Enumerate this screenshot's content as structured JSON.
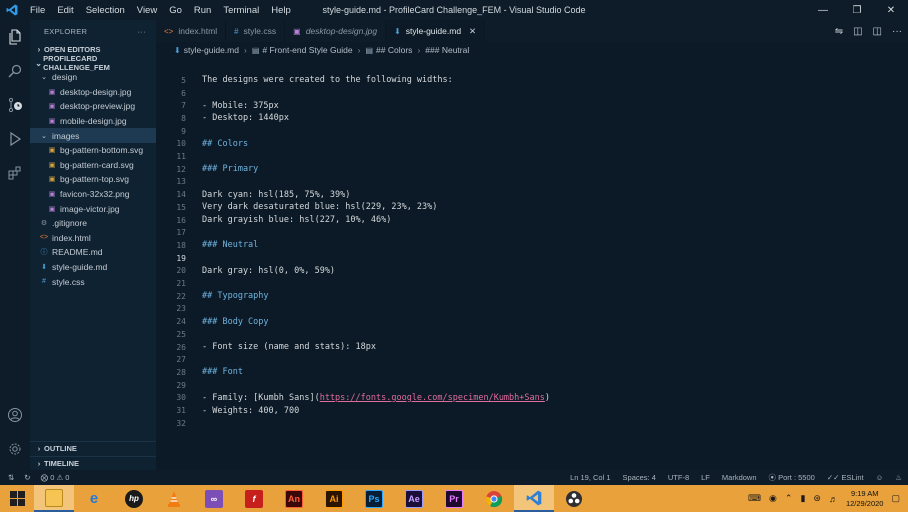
{
  "window": {
    "title": "style-guide.md - ProfileCard Challenge_FEM - Visual Studio Code",
    "menu": [
      "File",
      "Edit",
      "Selection",
      "View",
      "Go",
      "Run",
      "Terminal",
      "Help"
    ]
  },
  "sidebar": {
    "explorer_label": "EXPLORER",
    "open_editors_label": "OPEN EDITORS",
    "project_label": "PROFILECARD CHALLENGE_FEM",
    "tree": [
      {
        "label": "design",
        "kind": "folder",
        "depth": 1,
        "icon": "chevron-down-icon"
      },
      {
        "label": "desktop-design.jpg",
        "kind": "image",
        "depth": 2,
        "icon": "image-file-icon"
      },
      {
        "label": "desktop-preview.jpg",
        "kind": "image",
        "depth": 2,
        "icon": "image-file-icon"
      },
      {
        "label": "mobile-design.jpg",
        "kind": "image",
        "depth": 2,
        "icon": "image-file-icon"
      },
      {
        "label": "images",
        "kind": "folder",
        "depth": 1,
        "icon": "chevron-down-icon",
        "selected": true
      },
      {
        "label": "bg-pattern-bottom.svg",
        "kind": "svg",
        "depth": 2,
        "icon": "image-file-icon"
      },
      {
        "label": "bg-pattern-card.svg",
        "kind": "svg",
        "depth": 2,
        "icon": "image-file-icon"
      },
      {
        "label": "bg-pattern-top.svg",
        "kind": "svg",
        "depth": 2,
        "icon": "image-file-icon"
      },
      {
        "label": "favicon-32x32.png",
        "kind": "image",
        "depth": 2,
        "icon": "image-file-icon"
      },
      {
        "label": "image-victor.jpg",
        "kind": "image",
        "depth": 2,
        "icon": "image-file-icon"
      },
      {
        "label": ".gitignore",
        "kind": "config",
        "depth": 1,
        "icon": "gear-icon"
      },
      {
        "label": "index.html",
        "kind": "html",
        "depth": 1,
        "icon": "code-file-icon"
      },
      {
        "label": "README.md",
        "kind": "info",
        "depth": 1,
        "icon": "info-icon"
      },
      {
        "label": "style-guide.md",
        "kind": "markdown",
        "depth": 1,
        "icon": "markdown-icon"
      },
      {
        "label": "style.css",
        "kind": "css",
        "depth": 1,
        "icon": "hash-icon"
      }
    ],
    "outline_label": "OUTLINE",
    "timeline_label": "TIMELINE"
  },
  "tabs": [
    {
      "label": "index.html",
      "icon": "code-file-icon",
      "active": false
    },
    {
      "label": "style.css",
      "icon": "hash-icon",
      "active": false
    },
    {
      "label": "desktop-design.jpg",
      "icon": "image-file-icon",
      "active": false
    },
    {
      "label": "style-guide.md",
      "icon": "markdown-icon",
      "active": true
    }
  ],
  "breadcrumb": [
    "style-guide.md",
    "# Front-end Style Guide",
    "## Colors",
    "### Neutral"
  ],
  "editor": {
    "current_line": 19,
    "lines": [
      {
        "n": 5,
        "text": "The designs were created to the following widths:",
        "kind": "text"
      },
      {
        "n": 6,
        "text": "",
        "kind": "text"
      },
      {
        "n": 7,
        "text": "- Mobile: 375px",
        "kind": "text"
      },
      {
        "n": 8,
        "text": "- Desktop: 1440px",
        "kind": "text"
      },
      {
        "n": 9,
        "text": "",
        "kind": "text"
      },
      {
        "n": 10,
        "text": "## Colors",
        "kind": "heading"
      },
      {
        "n": 11,
        "text": "",
        "kind": "text"
      },
      {
        "n": 12,
        "text": "### Primary",
        "kind": "heading"
      },
      {
        "n": 13,
        "text": "",
        "kind": "text"
      },
      {
        "n": 14,
        "text": "Dark cyan: hsl(185, 75%, 39%)",
        "kind": "text"
      },
      {
        "n": 15,
        "text": "Very dark desaturated blue: hsl(229, 23%, 23%)",
        "kind": "text"
      },
      {
        "n": 16,
        "text": "Dark grayish blue: hsl(227, 10%, 46%)",
        "kind": "text"
      },
      {
        "n": 17,
        "text": "",
        "kind": "text"
      },
      {
        "n": 18,
        "text": "### Neutral",
        "kind": "heading"
      },
      {
        "n": 19,
        "text": "",
        "kind": "text"
      },
      {
        "n": 20,
        "text": "Dark gray: hsl(0, 0%, 59%)",
        "kind": "text"
      },
      {
        "n": 21,
        "text": "",
        "kind": "text"
      },
      {
        "n": 22,
        "text": "## Typography",
        "kind": "heading"
      },
      {
        "n": 23,
        "text": "",
        "kind": "text"
      },
      {
        "n": 24,
        "text": "### Body Copy",
        "kind": "heading"
      },
      {
        "n": 25,
        "text": "",
        "kind": "text"
      },
      {
        "n": 26,
        "text": "- Font size (name and stats): 18px",
        "kind": "text"
      },
      {
        "n": 27,
        "text": "",
        "kind": "text"
      },
      {
        "n": 28,
        "text": "### Font",
        "kind": "heading"
      },
      {
        "n": 29,
        "text": "",
        "kind": "text"
      },
      {
        "n": 30,
        "kind": "link",
        "prefix": "- Family: [Kumbh Sans](",
        "url": "https://fonts.google.com/specimen/Kumbh+Sans",
        "suffix": ")"
      },
      {
        "n": 31,
        "text": "- Weights: 400, 700",
        "kind": "text"
      },
      {
        "n": 32,
        "text": "",
        "kind": "text"
      }
    ]
  },
  "statusbar": {
    "errors": "0",
    "warnings": "0",
    "position": "Ln 19, Col 1",
    "spaces": "Spaces: 4",
    "encoding": "UTF-8",
    "eol": "LF",
    "language": "Markdown",
    "port": "Port : 5500",
    "eslint": "ESLint"
  },
  "taskbar": {
    "time": "9:19 AM",
    "date": "12/29/2020",
    "apps": [
      {
        "name": "file-explorer",
        "label": ""
      },
      {
        "name": "internet-explorer",
        "label": "e"
      },
      {
        "name": "hp",
        "label": "hp"
      },
      {
        "name": "vlc",
        "label": ""
      },
      {
        "name": "visual-studio",
        "label": ""
      },
      {
        "name": "flash",
        "label": "f"
      },
      {
        "name": "animate",
        "label": "An"
      },
      {
        "name": "illustrator",
        "label": "Ai"
      },
      {
        "name": "photoshop",
        "label": "Ps"
      },
      {
        "name": "after-effects",
        "label": "Ae"
      },
      {
        "name": "premiere",
        "label": "Pr"
      },
      {
        "name": "chrome",
        "label": ""
      },
      {
        "name": "vscode",
        "label": ""
      },
      {
        "name": "obs",
        "label": ""
      }
    ]
  }
}
